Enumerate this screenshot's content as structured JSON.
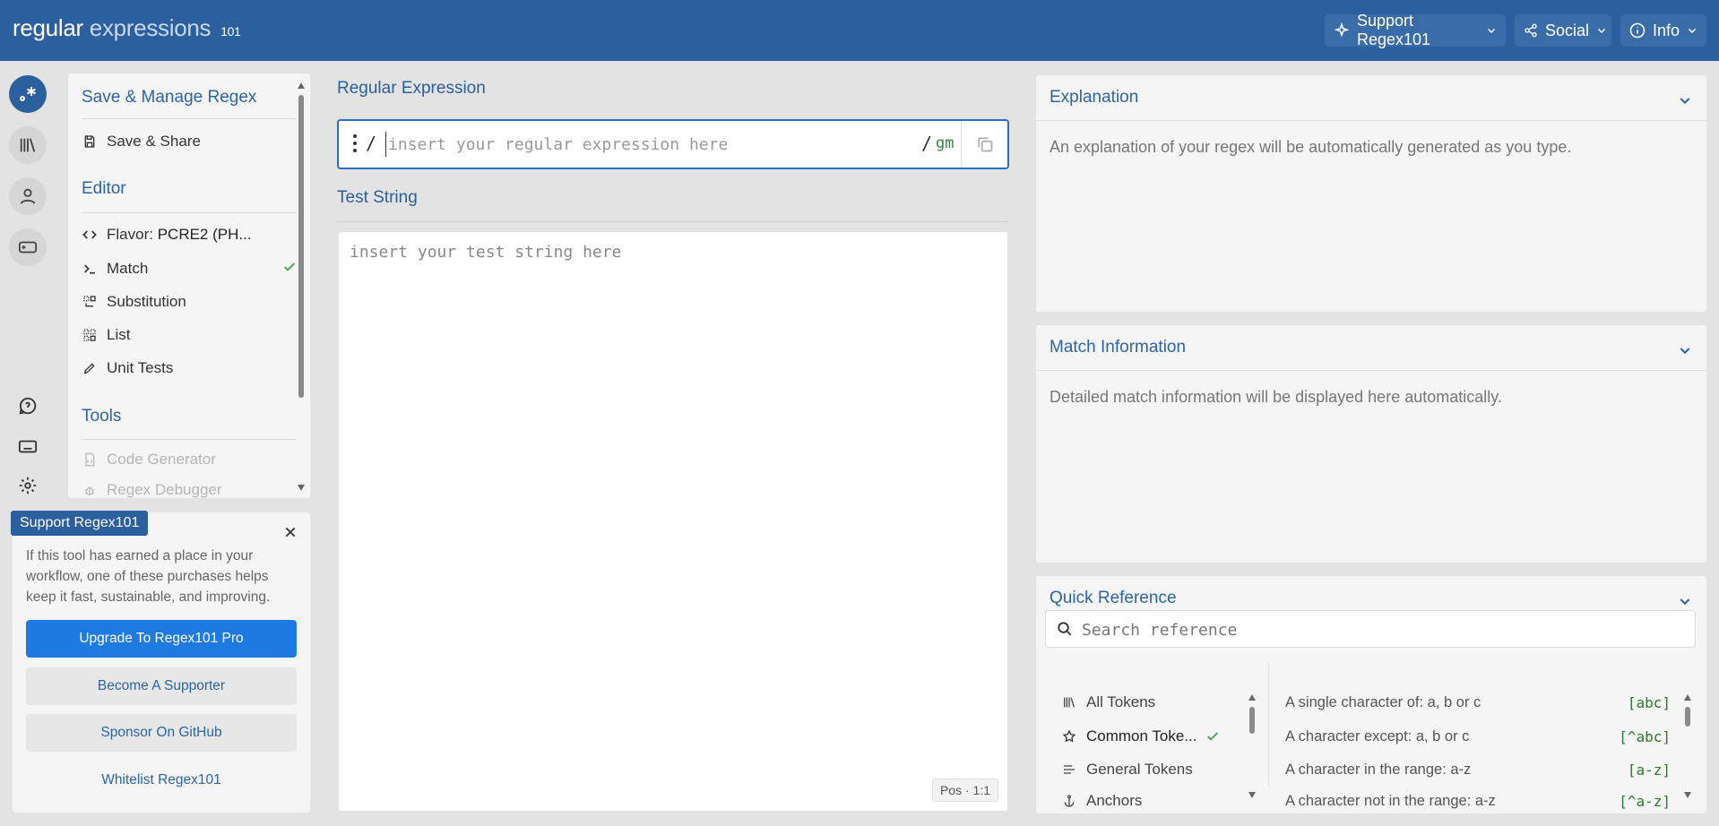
{
  "header": {
    "logo_main": "regular",
    "logo_light": "expressions",
    "logo_version": "101",
    "support_label": "Support Regex101",
    "social_label": "Social",
    "info_label": "Info"
  },
  "sidebar": {
    "save_heading": "Save & Manage Regex",
    "save_share_label": "Save & Share",
    "editor_heading": "Editor",
    "flavor_prefix": "Flavor:",
    "flavor_value": "PCRE2 (PH...",
    "match_label": "Match",
    "substitution_label": "Substitution",
    "list_label": "List",
    "unit_tests_label": "Unit Tests",
    "tools_heading": "Tools",
    "code_generator_label": "Code Generator",
    "regex_debugger_label": "Regex Debugger"
  },
  "support": {
    "tag": "Support Regex101",
    "text": "If this tool has earned a place in your workflow, one of these purchases helps keep it fast, sustainable, and improving.",
    "upgrade_label": "Upgrade To Regex101 Pro",
    "supporter_label": "Become A Supporter",
    "github_label": "Sponsor On GitHub",
    "whitelist_label": "Whitelist Regex101"
  },
  "editor": {
    "regex_title": "Regular Expression",
    "delimiter_open": "/",
    "regex_placeholder": "insert your regular expression here",
    "delimiter_close": "/",
    "flags": "gm",
    "test_title": "Test String",
    "test_placeholder": "insert your test string here",
    "pos": "Pos · 1:1"
  },
  "explanation": {
    "title": "Explanation",
    "body": "An explanation of your regex will be automatically generated as you type."
  },
  "match_info": {
    "title": "Match Information",
    "body": "Detailed match information will be displayed here automatically."
  },
  "quick_ref": {
    "title": "Quick Reference",
    "search_placeholder": "Search reference",
    "categories": [
      "All Tokens",
      "Common Toke...",
      "General Tokens",
      "Anchors"
    ],
    "rows": [
      {
        "desc": "A single character of: a, b or c",
        "token": "[abc]"
      },
      {
        "desc": "A character except: a, b or c",
        "token": "[^abc]"
      },
      {
        "desc": "A character in the range: a-z",
        "token": "[a-z]"
      },
      {
        "desc": "A character not in the range: a-z",
        "token": "[^a-z]"
      }
    ]
  },
  "colors": {
    "header_bg": "#2b5f9e",
    "accent": "#2b64a8",
    "primary_button": "#1e7ae0",
    "flag_green": "#2b8a3e"
  }
}
